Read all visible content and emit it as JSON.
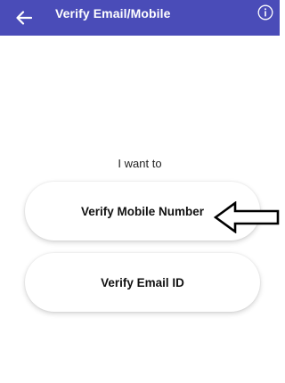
{
  "header": {
    "title": "Verify Email/Mobile",
    "back_icon": "arrow-left-icon",
    "info_icon": "info-circle-icon",
    "background_color": "#4a4cb8"
  },
  "main": {
    "prompt": "I want to",
    "options": [
      {
        "label": "Verify Mobile Number"
      },
      {
        "label": "Verify Email ID"
      }
    ]
  },
  "annotation": {
    "icon": "left-pointing-arrow-icon"
  }
}
